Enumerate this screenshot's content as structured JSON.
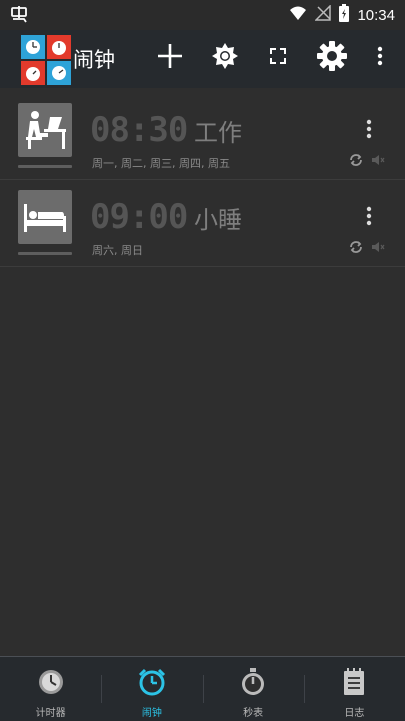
{
  "status_bar": {
    "time": "10:34"
  },
  "app_bar": {
    "title": "闹钟",
    "actions": [
      "add-icon",
      "brightness-icon",
      "fullscreen-icon",
      "settings-icon",
      "more-icon"
    ]
  },
  "alarms": [
    {
      "time": "08:30",
      "label": "工作",
      "days": "周一, 周二, 周三, 周四, 周五",
      "icon": "work-desk-icon"
    },
    {
      "time": "09:00",
      "label": "小睡",
      "days": "周六, 周日",
      "icon": "bed-icon"
    }
  ],
  "bottom_nav": {
    "tabs": [
      {
        "label": "计时器",
        "icon": "timer-icon"
      },
      {
        "label": "闹钟",
        "icon": "alarm-clock-icon",
        "active": true
      },
      {
        "label": "秒表",
        "icon": "stopwatch-icon"
      },
      {
        "label": "日志",
        "icon": "log-icon"
      }
    ]
  },
  "colors": {
    "accent": "#2cc3e6",
    "background": "#2e2e2e",
    "bar": "#262a2e"
  }
}
